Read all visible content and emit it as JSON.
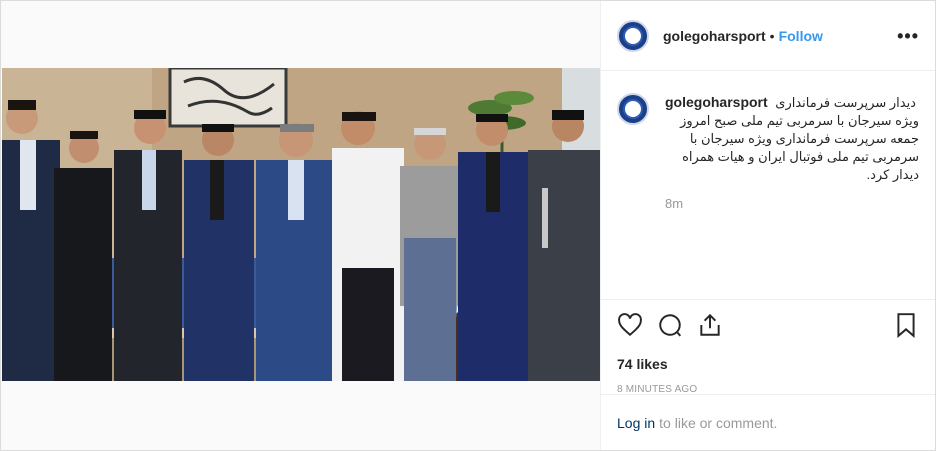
{
  "header": {
    "username": "golegoharsport",
    "separator": "•",
    "follow_label": "Follow",
    "more_label": "•••"
  },
  "caption": {
    "username": "golegoharsport",
    "text_line1": "دیدار سرپرست فرمانداری",
    "text_rest": "ویژه سیرجان با سرمربی تیم ملی صبح امروز جمعه سرپرست فرمانداری ویژه سیرجان با سرمربی تیم ملی فوتبال ایران و هیات همراه دیدار کرد.",
    "time": "8m"
  },
  "actions": {
    "likes": "74 likes",
    "posted_ago": "8 MINUTES AGO"
  },
  "comment_box": {
    "login_label": "Log in",
    "rest_text": "to like or comment."
  },
  "icons": {
    "like": "heart-icon",
    "comment": "comment-bubble-icon",
    "share": "share-icon",
    "save": "bookmark-icon"
  },
  "colors": {
    "follow": "#3897f0",
    "login": "#003569",
    "muted": "#999999"
  }
}
